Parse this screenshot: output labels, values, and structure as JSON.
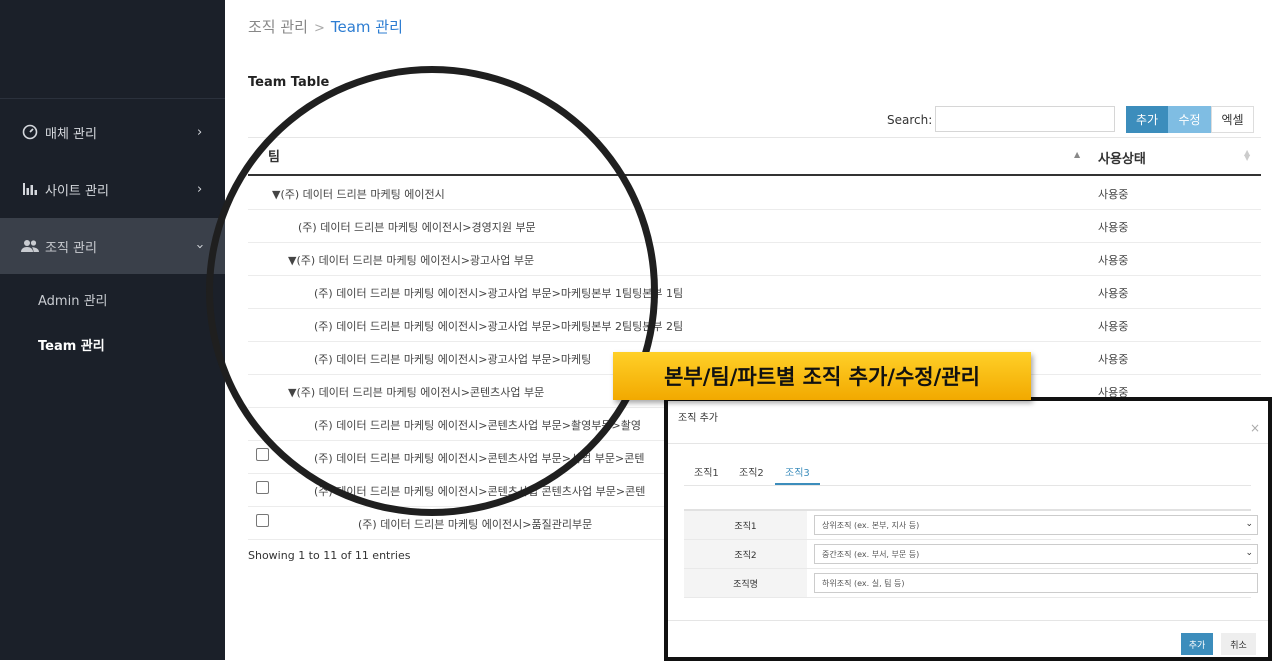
{
  "sidebar": {
    "items": [
      {
        "label": "매체 관리",
        "icon": "gauge-icon"
      },
      {
        "label": "사이트 관리",
        "icon": "bar-chart-icon"
      },
      {
        "label": "조직 관리",
        "icon": "users-icon"
      }
    ],
    "subitems": [
      {
        "label": "Admin 관리"
      },
      {
        "label": "Team 관리"
      }
    ]
  },
  "breadcrumb": {
    "parent": "조직 관리",
    "separator": ">",
    "current": "Team 관리"
  },
  "table": {
    "title": "Team Table",
    "search_label": "Search:",
    "buttons": {
      "add": "추가",
      "edit": "수정",
      "excel": "엑셀"
    },
    "columns": {
      "team": "팀",
      "status": "사용상태"
    },
    "rows": [
      {
        "name": "▼(주) 데이터 드리븐 마케팅 에이전시",
        "status": "사용중"
      },
      {
        "name": "(주) 데이터 드리븐 마케팅 에이전시>경영지원 부문",
        "status": "사용중"
      },
      {
        "name": "▼(주) 데이터 드리븐 마케팅 에이전시>광고사업 부문",
        "status": "사용중"
      },
      {
        "name": "(주) 데이터 드리븐 마케팅 에이전시>광고사업 부문>마케팅본부 1팀팅본부 1팀",
        "status": "사용중"
      },
      {
        "name": "(주) 데이터 드리븐 마케팅 에이전시>광고사업 부문>마케팅본부 2팀팅본부 2팀",
        "status": "사용중"
      },
      {
        "name": "(주) 데이터 드리븐 마케팅 에이전시>광고사업 부문>마케팅",
        "status": "사용중"
      },
      {
        "name": "▼(주) 데이터 드리븐 마케팅 에이전시>콘텐츠사업 부문",
        "status": "사용중"
      },
      {
        "name": "(주) 데이터 드리븐 마케팅 에이전시>콘텐츠사업 부문>촬영부문>촬영",
        "status": ""
      },
      {
        "name": "(주) 데이터 드리븐 마케팅 에이전시>콘텐츠사업 부문>사업 부문>콘텐",
        "status": ""
      },
      {
        "name": "(주) 데이터 드리븐 마케팅 에이전시>콘텐츠사업 콘텐츠사업 부문>콘텐",
        "status": ""
      },
      {
        "name": "(주) 데이터 드리븐 마케팅 에이전시>품질관리부문",
        "status": ""
      }
    ],
    "info": "Showing 1 to 11 of 11 entries"
  },
  "banner": "본부/팀/파트별 조직 추가/수정/관리",
  "modal": {
    "title": "조직 추가",
    "close": "×",
    "tabs": [
      "조직1",
      "조직2",
      "조직3"
    ],
    "fields": [
      {
        "label": "조직1",
        "value": "상위조직 (ex. 본부, 지사 등)"
      },
      {
        "label": "조직2",
        "value": "중간조직 (ex. 부서, 부문 등)"
      },
      {
        "label": "조직명",
        "placeholder": "하위조직 (ex. 실, 팀 등)"
      }
    ],
    "buttons": {
      "add": "추가",
      "cancel": "취소"
    }
  },
  "colors": {
    "sidebar_bg": "#1b2029",
    "accent": "#3c8dbc",
    "banner": "#f5b400"
  }
}
